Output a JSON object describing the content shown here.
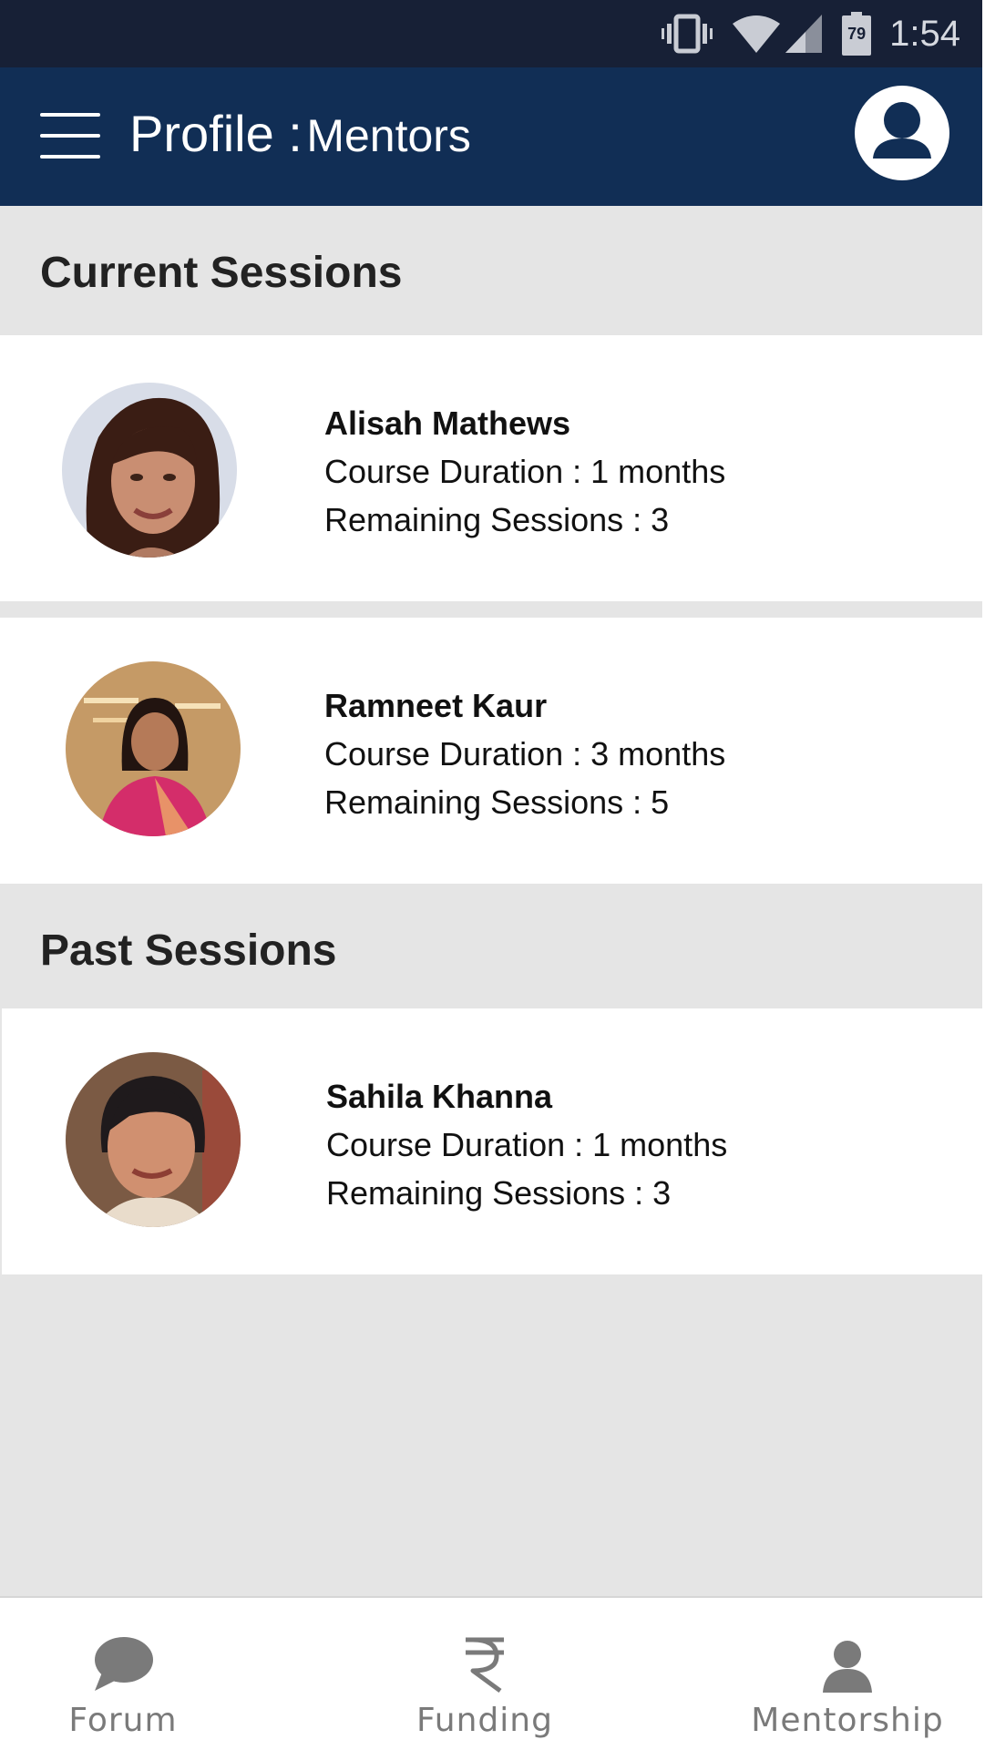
{
  "status_bar": {
    "time": "1:54",
    "battery_level": "79",
    "icons": [
      "vibrate-icon",
      "wifi-icon",
      "cell-signal-icon",
      "battery-icon"
    ]
  },
  "app_bar": {
    "title_main": "Profile :",
    "title_sub": "Mentors",
    "menu_icon": "hamburger-icon",
    "profile_icon": "user-icon"
  },
  "current_sessions": {
    "heading": "Current Sessions",
    "mentors": [
      {
        "name": "Alisah Mathews",
        "duration": "Course Duration : 1 months",
        "remaining": "Remaining Sessions : 3"
      },
      {
        "name": "Ramneet Kaur",
        "duration": "Course Duration : 3 months",
        "remaining": "Remaining Sessions : 5"
      }
    ]
  },
  "past_sessions": {
    "heading": "Past Sessions",
    "mentors": [
      {
        "name": "Sahila Khanna",
        "duration": "Course Duration : 1 months",
        "remaining": "Remaining Sessions : 3"
      }
    ]
  },
  "bottom_nav": {
    "items": [
      {
        "label": "Forum",
        "icon": "chat-bubble-icon"
      },
      {
        "label": "Funding",
        "icon": "rupee-icon"
      },
      {
        "label": "Mentorship",
        "icon": "person-icon"
      }
    ]
  },
  "colors": {
    "status_bar_bg": "#172036",
    "app_bar_bg": "#112e55",
    "page_bg": "#e5e5e5",
    "card_bg": "#ffffff",
    "nav_icon": "#7a7a7a"
  }
}
